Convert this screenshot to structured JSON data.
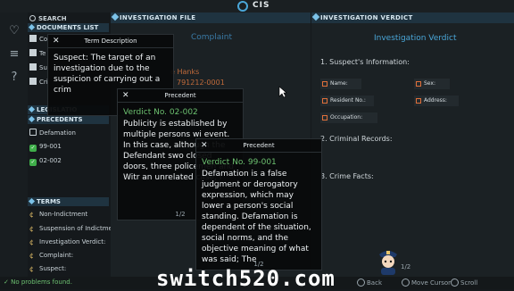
{
  "app": {
    "title": "CIS"
  },
  "left": {
    "search_label": "SEARCH",
    "documents_label": "DOCUMENTS LIST",
    "documents": [
      "Co",
      "Te",
      "Su",
      "Cri"
    ],
    "legislation_label": "LEGISLATIO",
    "precedents_label": "PRECEDENTS",
    "precedents": [
      "Defamation",
      "99-001",
      "02-002"
    ],
    "terms_label": "TERMS",
    "terms": [
      "Non-Indictment",
      "Suspension of Indictment:",
      "Investigation Verdict:",
      "Complaint:",
      "Suspect:"
    ]
  },
  "file_panel": {
    "header": "INVESTIGATION FILE",
    "title": "Complaint",
    "name_fragment": "e Hanks",
    "id_fragment": "791212-0001",
    "page_fragment": "1"
  },
  "verdict_panel": {
    "header": "INVESTIGATION VERDICT",
    "title": "Investigation Verdict",
    "suspect_info": "1. Suspect's Information:",
    "fields": [
      "Name:",
      "Sex:",
      "Resident No.:",
      "Address:",
      "Occupation:"
    ],
    "criminal_records": "2. Criminal Records:",
    "crime_facts": "3. Crime Facts:",
    "page": "1/2"
  },
  "popups": {
    "term": {
      "title": "Term Description",
      "body": "Suspect: The target of an investigation due to the suspicion of carrying out a crim"
    },
    "precedent1": {
      "title": "Precedent",
      "verdict": "Verdict No. 02-002",
      "body": "Publicity is established by multiple persons wi event. In this case, although the Defendant swo closed doors, three policemen and Witr an unrelated case, I",
      "page": "1/2"
    },
    "precedent2": {
      "title": "Precedent",
      "verdict": "Verdict No. 99-001",
      "body": "Defamation is a false judgment or derogatory expression, which may lower a person's social standing. Defamation is dependent of the situation, social norms, and the objective meaning of what was said; The",
      "page": "1/2"
    }
  },
  "status": {
    "text": "No problems found.",
    "hints": [
      "Back",
      "Move Cursor",
      "Scroll"
    ]
  },
  "watermark": "switch520.com",
  "colors": {
    "accent": "#4aa6d8",
    "green": "#3fae4a",
    "orange": "#e0703a"
  }
}
